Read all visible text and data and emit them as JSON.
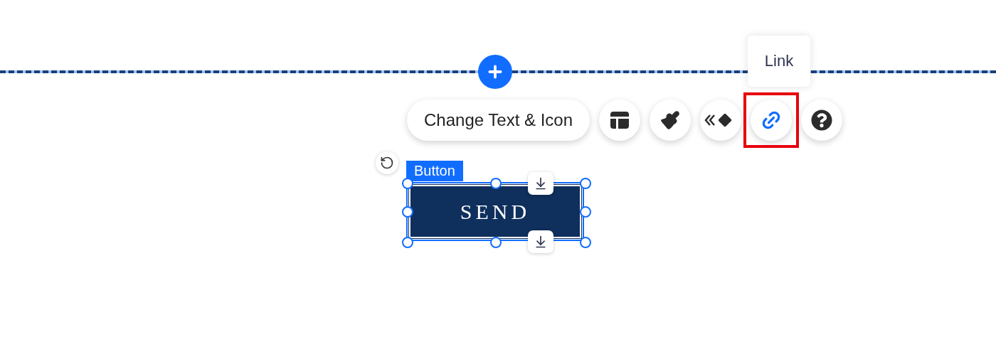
{
  "tooltip": {
    "text": "Link"
  },
  "toolbar": {
    "main_button": "Change Text & Icon",
    "icon_buttons": [
      {
        "kind": "layout",
        "selected": false
      },
      {
        "kind": "design",
        "selected": false
      },
      {
        "kind": "animation",
        "selected": false
      },
      {
        "kind": "link",
        "selected": true
      },
      {
        "kind": "help",
        "selected": false
      }
    ]
  },
  "element": {
    "tag": "Button",
    "text": "SEND"
  }
}
